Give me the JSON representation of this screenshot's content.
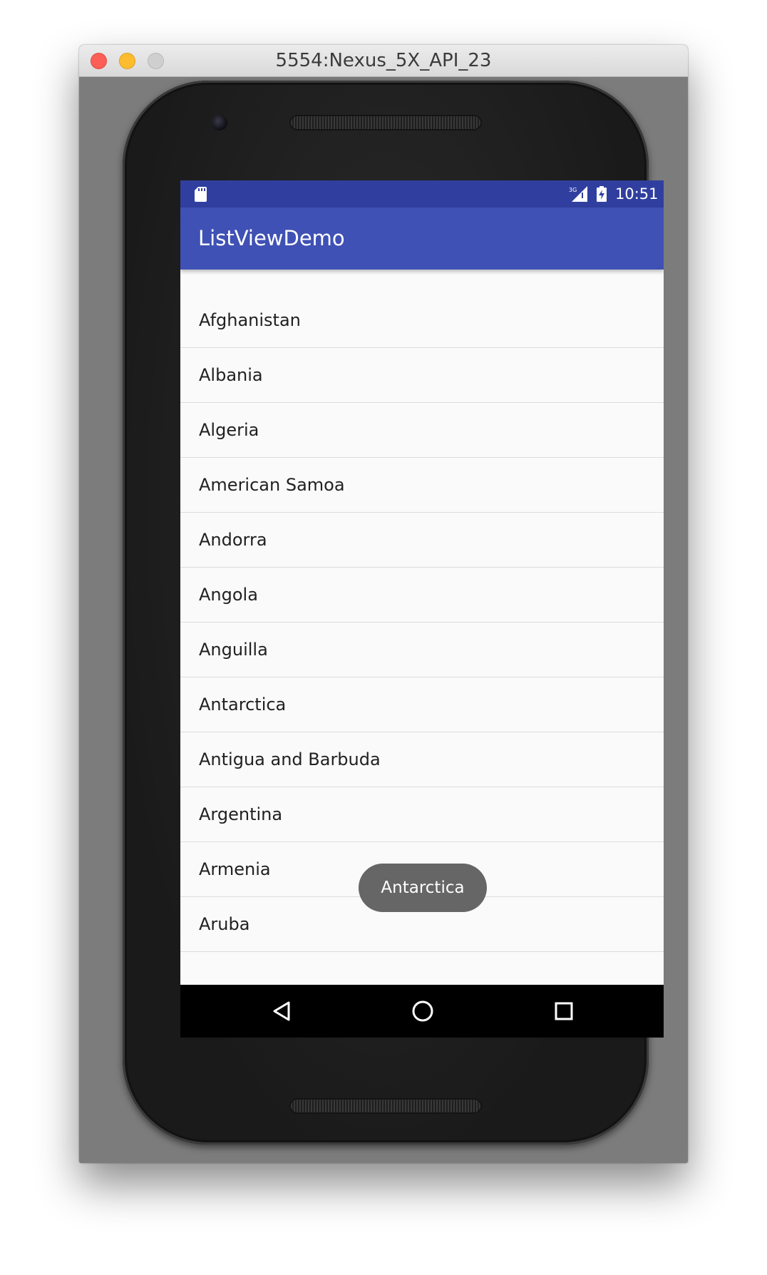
{
  "window": {
    "title": "5554:Nexus_5X_API_23"
  },
  "status_bar": {
    "time": "10:51",
    "icons": [
      "sd-card-icon",
      "no-data-signal-icon",
      "battery-charging-icon"
    ],
    "color": "#303f9f"
  },
  "app_bar": {
    "title": "ListViewDemo",
    "color": "#3f51b5"
  },
  "list": {
    "items": [
      "Afghanistan",
      "Albania",
      "Algeria",
      "American Samoa",
      "Andorra",
      "Angola",
      "Anguilla",
      "Antarctica",
      "Antigua and Barbuda",
      "Argentina",
      "Armenia",
      "Aruba"
    ]
  },
  "toast": {
    "text": "Antarctica"
  },
  "nav_bar": {
    "buttons": [
      "back-icon",
      "home-icon",
      "recents-icon"
    ]
  }
}
